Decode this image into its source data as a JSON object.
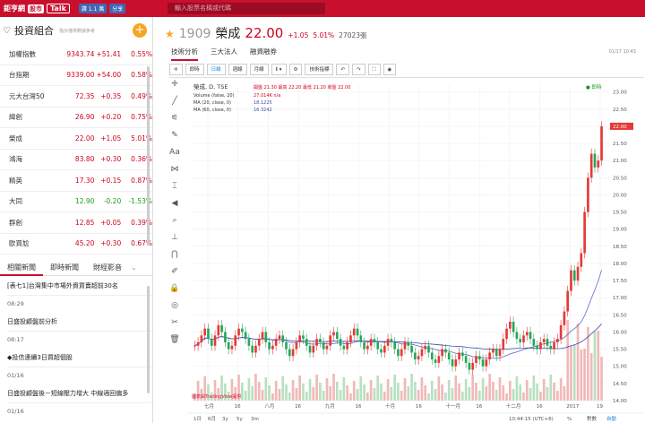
{
  "header": {
    "logo": "鉅亨網",
    "logo_badge": "股市",
    "logo_talk": "Talk",
    "like_label": "讚 1.1 萬",
    "share_label": "分享",
    "search_placeholder": "輸入股票名稱或代碼"
  },
  "portfolio": {
    "title": "投資組合",
    "subtitle": "指示僅供數據參考",
    "items": [
      {
        "name": "加權指數",
        "price": "9343.74",
        "change": "+51.41",
        "pct": "0.55%",
        "dir": "up"
      },
      {
        "name": "台指期",
        "price": "9339.00",
        "change": "+54.00",
        "pct": "0.58%",
        "dir": "up"
      },
      {
        "name": "元大台灣50",
        "price": "72.35",
        "change": "+0.35",
        "pct": "0.49%",
        "dir": "up"
      },
      {
        "name": "緯創",
        "price": "26.90",
        "change": "+0.20",
        "pct": "0.75%",
        "dir": "up"
      },
      {
        "name": "榮成",
        "price": "22.00",
        "change": "+1.05",
        "pct": "5.01%",
        "dir": "up"
      },
      {
        "name": "鴻海",
        "price": "83.80",
        "change": "+0.30",
        "pct": "0.36%",
        "dir": "up"
      },
      {
        "name": "精英",
        "price": "17.30",
        "change": "+0.15",
        "pct": "0.87%",
        "dir": "up"
      },
      {
        "name": "大同",
        "price": "12.90",
        "change": "-0.20",
        "pct": "-1.53%",
        "dir": "dn"
      },
      {
        "name": "群創",
        "price": "12.85",
        "change": "+0.05",
        "pct": "0.39%",
        "dir": "up"
      },
      {
        "name": "歐買尬",
        "price": "45.20",
        "change": "+0.30",
        "pct": "0.67%",
        "dir": "up"
      }
    ]
  },
  "news_tabs": [
    "相關新聞",
    "即時新聞",
    "財經影音"
  ],
  "news": [
    {
      "title": "[表七1]台灣集中市場外資買賣超前30名",
      "time": "08:29"
    },
    {
      "title": "日盛投顧盤前分析",
      "time": "08:17"
    },
    {
      "title": "◆投信連續3日買超個股",
      "time": "01/16"
    },
    {
      "title": "日盛投顧盤後－短線壓力增大 中線適回偏多",
      "time": "01/16"
    }
  ],
  "quote": {
    "code": "1909",
    "name": "榮成",
    "price": "22.00",
    "change": "+1.05",
    "pct": "5.01%",
    "volume": "27023張",
    "datetime": "01/17 10:43"
  },
  "subtabs": [
    "技術分析",
    "三大法人",
    "融資融券"
  ],
  "toolbar": {
    "buttons": [
      "即時",
      "日線",
      "週線",
      "月線",
      "技術指標"
    ]
  },
  "chart_data": {
    "type": "candlestick",
    "title": "榮成, D, TSE",
    "ohlc_label": "開盤 21.30 最高 22.20 最低 21.20 收盤 22.00",
    "indicators": [
      {
        "label": "Volume (false, 20)",
        "value": "27.014K n/a"
      },
      {
        "label": "MA (20, close, 0)",
        "value": "18.1225"
      },
      {
        "label": "MA (60, close, 0)",
        "value": "16.3242"
      }
    ],
    "status": "● 即時",
    "y_ticks": [
      "23.00",
      "22.50",
      "22.00",
      "21.50",
      "21.00",
      "20.50",
      "20.00",
      "19.50",
      "19.00",
      "18.50",
      "18.00",
      "17.50",
      "17.00",
      "16.50",
      "16.00",
      "15.50",
      "15.00",
      "14.50",
      "14.00"
    ],
    "x_ticks": [
      "七月",
      "16",
      "八月",
      "16",
      "九月",
      "16",
      "十月",
      "16",
      "十一月",
      "16",
      "十二月",
      "16",
      "2017",
      "19"
    ],
    "last_price_label": "22.00",
    "ranges": [
      "1日",
      "6月",
      "3y",
      "5y",
      "3m"
    ],
    "footer_time": "10:44:15 (UTC+8)",
    "footer_opts": [
      "%",
      "對數",
      "自動"
    ],
    "watermark": "圖表由TradingView提供",
    "ylim": [
      14.0,
      23.2
    ],
    "closes": [
      15.6,
      15.7,
      15.9,
      16.1,
      15.8,
      15.6,
      15.9,
      16.2,
      16.0,
      15.7,
      15.5,
      15.6,
      15.9,
      16.1,
      16.0,
      15.8,
      15.6,
      15.4,
      15.6,
      15.8,
      16.0,
      15.7,
      15.5,
      15.6,
      15.8,
      15.9,
      15.7,
      15.5,
      15.3,
      15.5,
      15.7,
      15.9,
      15.8,
      15.6,
      15.4,
      15.6,
      15.8,
      15.7,
      15.5,
      15.6,
      15.9,
      16.0,
      15.8,
      15.6,
      15.5,
      15.7,
      15.9,
      16.1,
      15.9,
      15.7,
      15.5,
      15.6,
      15.8,
      15.7,
      15.5,
      15.4,
      15.6,
      15.8,
      15.7,
      15.5,
      15.3,
      15.5,
      15.7,
      15.6,
      15.4,
      15.2,
      15.3,
      15.5,
      15.6,
      15.4,
      15.2,
      15.1,
      15.3,
      15.5,
      15.4,
      15.2,
      15.0,
      15.2,
      15.4,
      15.3,
      15.1,
      14.9,
      15.1,
      15.3,
      15.2,
      15.0,
      15.2,
      15.4,
      15.5,
      15.3,
      15.5,
      15.8,
      16.1,
      16.3,
      16.0,
      15.8,
      15.7,
      15.9,
      16.0,
      15.8,
      15.6,
      15.5,
      15.7,
      15.8,
      15.6,
      15.5,
      15.7,
      15.8,
      16.2,
      16.6,
      17.2,
      17.8,
      17.5,
      17.9,
      18.3,
      19.5,
      20.5,
      21.2,
      20.8,
      21.0,
      22.0
    ]
  }
}
